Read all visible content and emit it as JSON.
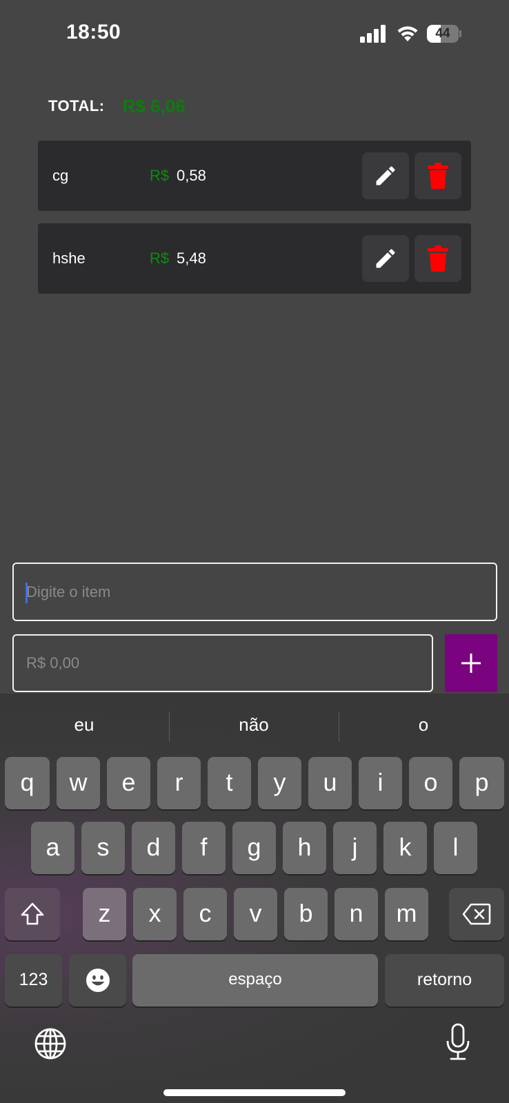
{
  "status_bar": {
    "time": "18:50",
    "battery_level": "44",
    "battery_fill_fraction": 0.44,
    "icons": [
      "cellular-signal-icon",
      "wifi-icon",
      "battery-icon"
    ]
  },
  "summary": {
    "total_label": "TOTAL:",
    "total_value": "R$ 6,06"
  },
  "items": [
    {
      "name": "cg",
      "currency": "R$",
      "price": "0,58"
    },
    {
      "name": "hshe",
      "currency": "R$",
      "price": "5,48"
    }
  ],
  "item_actions": {
    "edit_icon": "pencil-icon",
    "delete_icon": "trash-icon"
  },
  "form": {
    "item_placeholder": "Digite o item",
    "item_value": "",
    "price_placeholder": "R$ 0,00",
    "price_value": "",
    "add_icon": "plus-icon"
  },
  "keyboard": {
    "suggestions": [
      "eu",
      "não",
      "o"
    ],
    "row1": [
      "q",
      "w",
      "e",
      "r",
      "t",
      "y",
      "u",
      "i",
      "o",
      "p"
    ],
    "row2": [
      "a",
      "s",
      "d",
      "f",
      "g",
      "h",
      "j",
      "k",
      "l"
    ],
    "row3": [
      "z",
      "x",
      "c",
      "v",
      "b",
      "n",
      "m"
    ],
    "numbers_label": "123",
    "space_label": "espaço",
    "return_label": "retorno",
    "icons": [
      "shift-icon",
      "backspace-icon",
      "emoji-icon",
      "globe-icon",
      "microphone-icon"
    ]
  },
  "colors": {
    "background": "#454545",
    "card": "#2b2b2d",
    "money_green": "#0f8a0f",
    "delete_red": "#ff0000",
    "add_purple": "#7a047f"
  }
}
